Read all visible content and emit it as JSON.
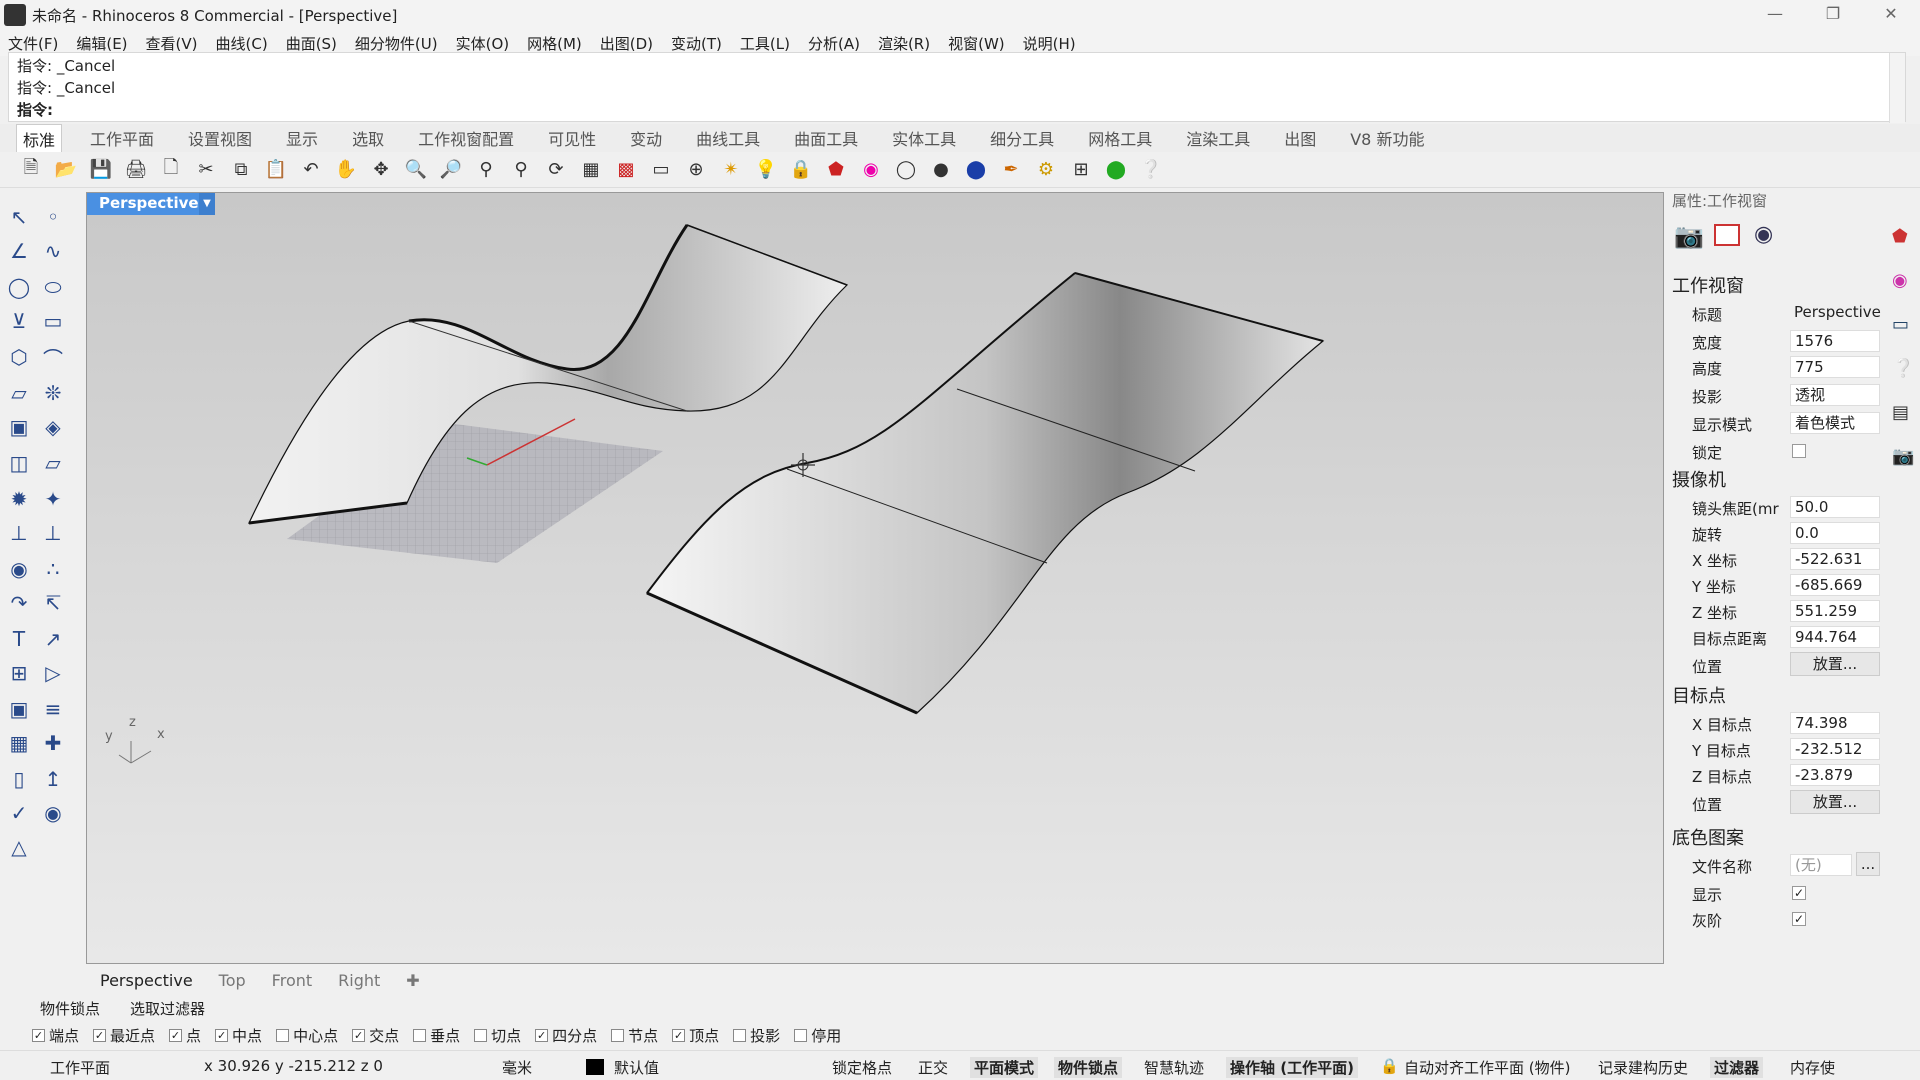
{
  "window": {
    "title": "未命名 - Rhinoceros 8 Commercial - [Perspective]"
  },
  "menu": [
    "文件(F)",
    "编辑(E)",
    "查看(V)",
    "曲线(C)",
    "曲面(S)",
    "细分物件(U)",
    "实体(O)",
    "网格(M)",
    "出图(D)",
    "变动(T)",
    "工具(L)",
    "分析(A)",
    "渲染(R)",
    "视窗(W)",
    "说明(H)"
  ],
  "command": {
    "history": [
      "指令: _Cancel",
      "指令: _Cancel"
    ],
    "prompt": "指令:"
  },
  "toolbar_tabs": [
    "标准",
    "工作平面",
    "设置视图",
    "显示",
    "选取",
    "工作视窗配置",
    "可见性",
    "变动",
    "曲线工具",
    "曲面工具",
    "实体工具",
    "细分工具",
    "网格工具",
    "渲染工具",
    "出图",
    "V8 新功能"
  ],
  "toolbar_icons": [
    "new-file-icon",
    "open-file-icon",
    "save-icon",
    "print-icon",
    "export-icon",
    "cut-icon",
    "copy-icon",
    "paste-icon",
    "undo-icon",
    "pan-hand-icon",
    "rotate-view-icon",
    "zoom-icon",
    "zoom-window-icon",
    "zoom-extents-icon",
    "zoom-selected-icon",
    "rotate-icon",
    "grid-icon",
    "car-icon",
    "layout-icon",
    "snap-icon",
    "lights-icon",
    "bulb-icon",
    "lock-icon",
    "material-icon",
    "color-wheel-icon",
    "sphere-wire-icon",
    "sphere-shaded-icon",
    "sphere-render-icon",
    "pen-icon",
    "gear-icon",
    "grid-snap-icon",
    "globe-icon",
    "help-icon"
  ],
  "viewport": {
    "name": "Perspective"
  },
  "viewport_tabs": [
    "Perspective",
    "Top",
    "Front",
    "Right"
  ],
  "panel": {
    "header": "属性:工作视窗",
    "sections": {
      "viewport": "工作视窗",
      "camera": "摄像机",
      "target": "目标点",
      "wallpaper": "底色图案"
    },
    "fields": {
      "title_label": "标题",
      "title": "Perspective",
      "width_label": "宽度",
      "width": "1576",
      "height_label": "高度",
      "height": "775",
      "projection_label": "投影",
      "projection": "透视",
      "display_label": "显示模式",
      "display": "着色模式",
      "lock_label": "锁定",
      "lens_label": "镜头焦距(mr",
      "lens": "50.0",
      "rotate_label": "旋转",
      "rotate": "0.0",
      "xcoord_label": "X 坐标",
      "xcoord": "-522.631",
      "ycoord_label": "Y 坐标",
      "ycoord": "-685.669",
      "zcoord_label": "Z 坐标",
      "zcoord": "551.259",
      "dist_label": "目标点距离",
      "dist": "944.764",
      "pos_label": "位置",
      "place_btn": "放置...",
      "xt_label": "X 目标点",
      "xt": "74.398",
      "yt_label": "Y 目标点",
      "yt": "-232.512",
      "zt_label": "Z 目标点",
      "zt": "-23.879",
      "pos2_label": "位置",
      "place_btn2": "放置...",
      "file_label": "文件名称",
      "file": "(无)",
      "file_btn": "...",
      "show_label": "显示",
      "gray_label": "灰阶"
    }
  },
  "osnap_tabs": [
    "物件锁点",
    "选取过滤器"
  ],
  "osnaps": [
    {
      "label": "端点",
      "checked": true
    },
    {
      "label": "最近点",
      "checked": true
    },
    {
      "label": "点",
      "checked": true
    },
    {
      "label": "中点",
      "checked": true
    },
    {
      "label": "中心点",
      "checked": false
    },
    {
      "label": "交点",
      "checked": true
    },
    {
      "label": "垂点",
      "checked": false
    },
    {
      "label": "切点",
      "checked": false
    },
    {
      "label": "四分点",
      "checked": true
    },
    {
      "label": "节点",
      "checked": false
    },
    {
      "label": "顶点",
      "checked": true
    },
    {
      "label": "投影",
      "checked": false
    },
    {
      "label": "停用",
      "checked": false
    }
  ],
  "status": {
    "cplane": "工作平面",
    "coords": "x 30.926  y -215.212  z 0",
    "units": "毫米",
    "layer": "默认值",
    "grid_snap": "锁定格点",
    "ortho": "正交",
    "planar": "平面模式",
    "osnap": "物件锁点",
    "smarttrack": "智慧轨迹",
    "gumball": "操作轴 (工作平面)",
    "autoalign": "自动对齐工作平面 (物件)",
    "history": "记录建构历史",
    "filter": "过滤器",
    "memory": "内存使"
  },
  "axis": {
    "x": "x",
    "y": "y",
    "z": "z"
  },
  "colors": {
    "accent": "#4a90e2",
    "viewport_bg_top": "#c8c8c8",
    "viewport_bg_bottom": "#e8e8e8"
  }
}
